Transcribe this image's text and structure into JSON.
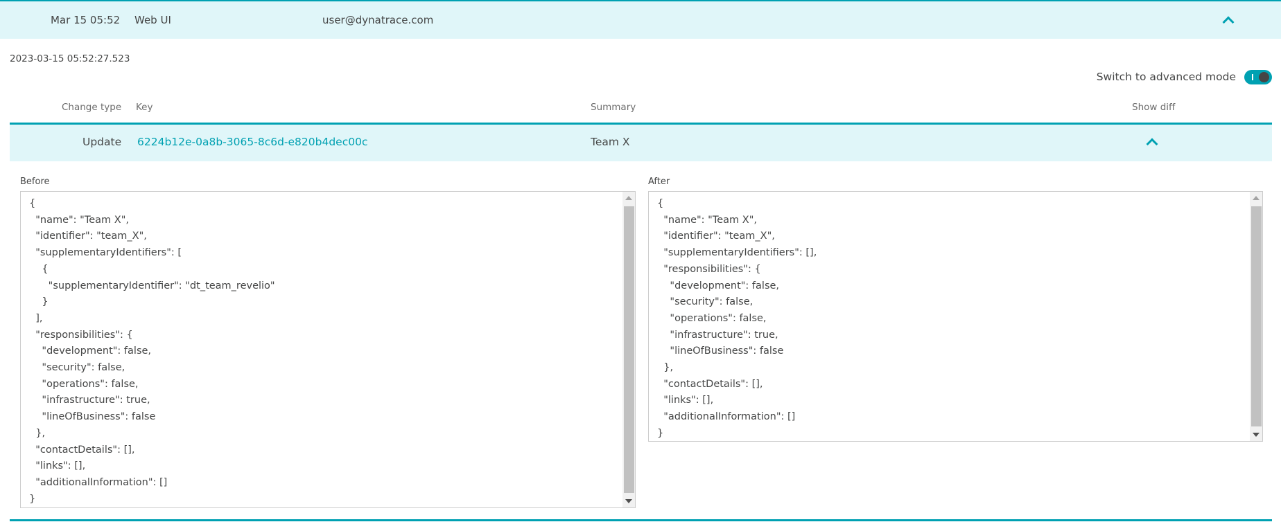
{
  "audit_row": {
    "date": "Mar 15 05:52",
    "source": "Web UI",
    "user": "user@dynatrace.com",
    "expanded_icon": "chevron-up-icon"
  },
  "detail": {
    "timestamp": "2023-03-15 05:52:27.523",
    "advanced_mode_label": "Switch to advanced mode",
    "advanced_mode_on": true
  },
  "table": {
    "headers": {
      "change_type": "Change type",
      "key": "Key",
      "summary": "Summary",
      "show_diff": "Show diff"
    },
    "rows": [
      {
        "change_type": "Update",
        "key": "6224b12e-0a8b-3065-8c6d-e820b4dec00c",
        "summary": "Team X",
        "show_diff_icon": "chevron-up-icon"
      }
    ]
  },
  "diff": {
    "before_label": "Before",
    "after_label": "After",
    "before_text": "{\n  \"name\": \"Team X\",\n  \"identifier\": \"team_X\",\n  \"supplementaryIdentifiers\": [\n    {\n      \"supplementaryIdentifier\": \"dt_team_revelio\"\n    }\n  ],\n  \"responsibilities\": {\n    \"development\": false,\n    \"security\": false,\n    \"operations\": false,\n    \"infrastructure\": true,\n    \"lineOfBusiness\": false\n  },\n  \"contactDetails\": [],\n  \"links\": [],\n  \"additionalInformation\": []\n}",
    "after_text": "{\n  \"name\": \"Team X\",\n  \"identifier\": \"team_X\",\n  \"supplementaryIdentifiers\": [],\n  \"responsibilities\": {\n    \"development\": false,\n    \"security\": false,\n    \"operations\": false,\n    \"infrastructure\": true,\n    \"lineOfBusiness\": false\n  },\n  \"contactDetails\": [],\n  \"links\": [],\n  \"additionalInformation\": []\n}"
  },
  "colors": {
    "accent": "#00a1b2",
    "row_highlight": "#e0f6f9",
    "text": "#454646"
  }
}
